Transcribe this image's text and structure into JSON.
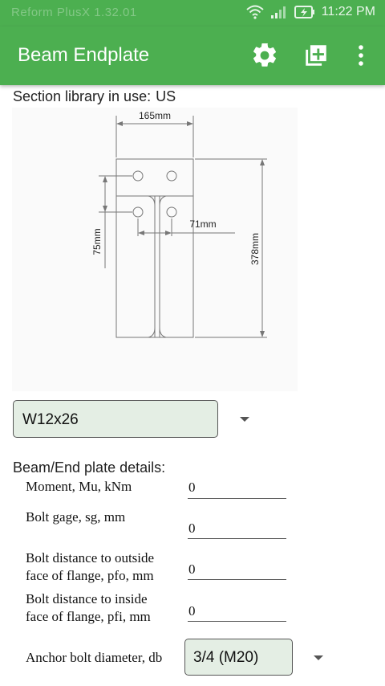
{
  "status_bar": {
    "carrier_text": "Reform PlusX 1.32.01",
    "time": "11:22 PM"
  },
  "app_bar": {
    "title": "Beam Endplate",
    "icons": [
      "gear-icon",
      "add-box-icon",
      "more-vert-icon"
    ]
  },
  "library": {
    "label": "Section library in use:",
    "value": "US"
  },
  "drawing": {
    "dimensions": {
      "width": "165mm",
      "gage": "71mm",
      "bolt_spacing": "75mm",
      "depth": "378mm"
    }
  },
  "section_select": {
    "value": "W12x26"
  },
  "details": {
    "heading": "Beam/End plate details:",
    "fields": [
      {
        "label": "Moment, Mu, kNm",
        "value": "0"
      },
      {
        "label": "Bolt gage, sg, mm",
        "value": "0"
      },
      {
        "label_line1": "Bolt distance to outside",
        "label_line2": "face of flange, pfo, mm",
        "value": "0"
      },
      {
        "label_line1": "Bolt distance to inside",
        "label_line2": "face of flange, pfi, mm",
        "value": "0"
      }
    ],
    "anchor": {
      "label": "Anchor bolt diameter, db",
      "value": "3/4 (M20)"
    }
  },
  "colors": {
    "primary": "#4caf50",
    "select_bg": "#e4eee4"
  }
}
